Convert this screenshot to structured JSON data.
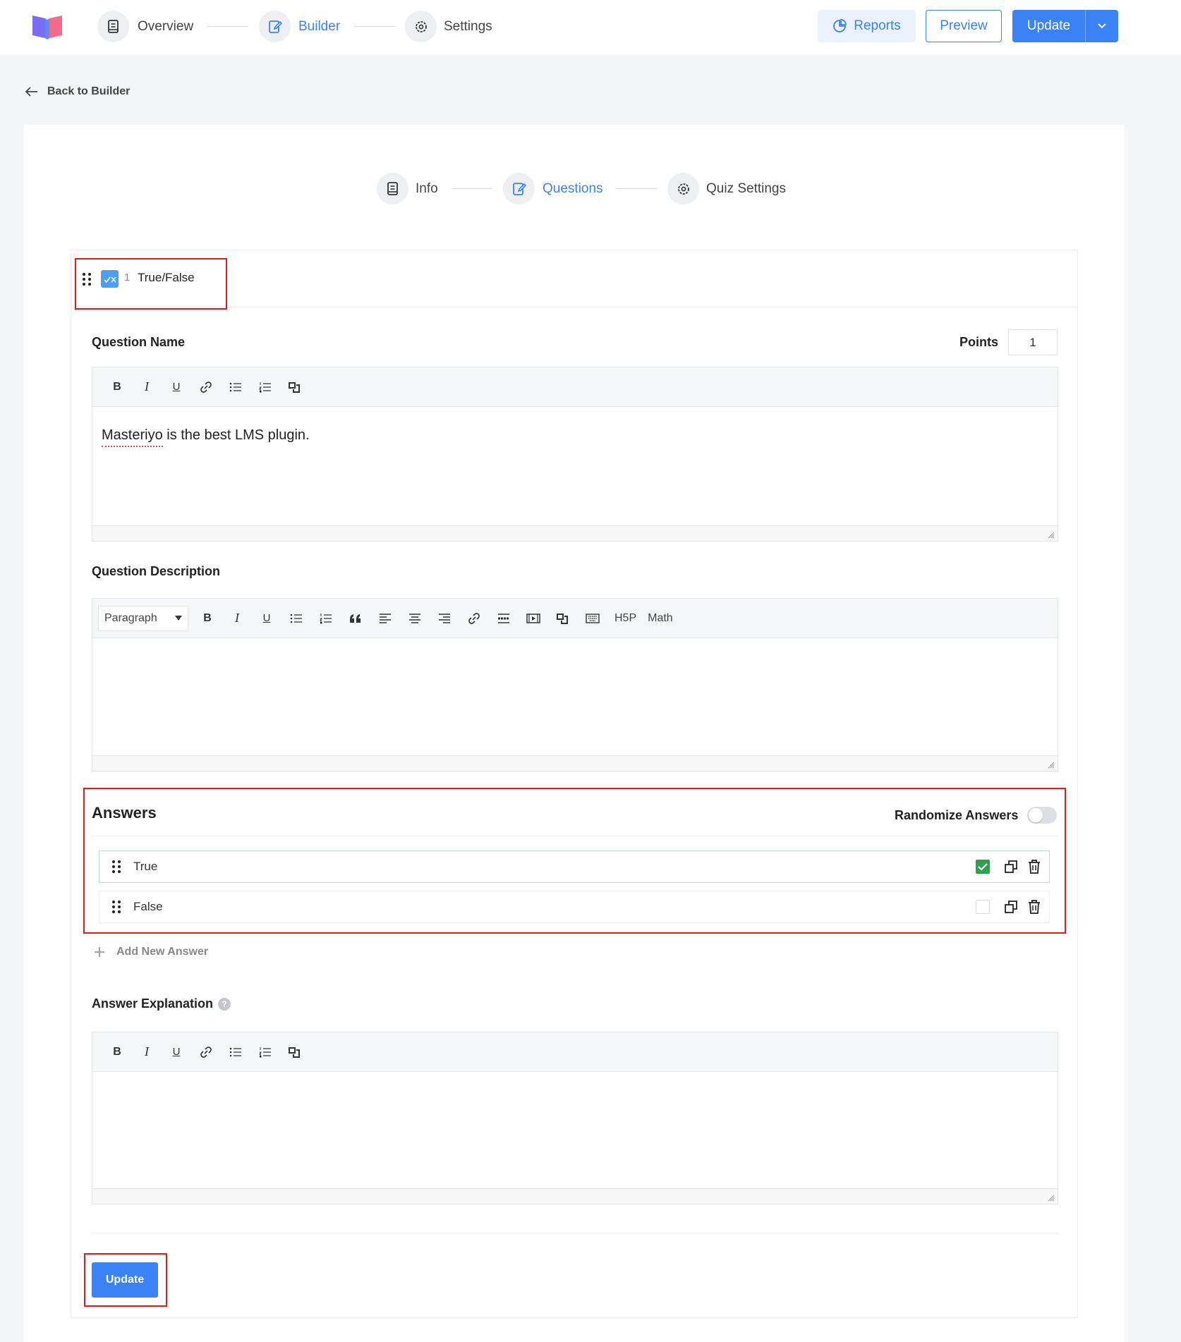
{
  "nav": {
    "steps": [
      {
        "label": "Overview",
        "icon": "book-icon"
      },
      {
        "label": "Builder",
        "icon": "edit-icon"
      },
      {
        "label": "Settings",
        "icon": "gear-icon"
      }
    ],
    "reports_label": "Reports",
    "preview_label": "Preview",
    "update_label": "Update"
  },
  "back_link": "Back to Builder",
  "quiz_steps": [
    {
      "label": "Info",
      "icon": "book-icon"
    },
    {
      "label": "Questions",
      "icon": "edit-icon"
    },
    {
      "label": "Quiz Settings",
      "icon": "gear-icon"
    }
  ],
  "question": {
    "number": "1",
    "type": "True/False",
    "name_label": "Question Name",
    "points_label": "Points",
    "points_value": "1",
    "name_text": "Masteriyo is the best LMS plugin.",
    "description_label": "Question Description",
    "format_select": "Paragraph",
    "toolbar_extra": {
      "h5p": "H5P",
      "math": "Math"
    },
    "answers_label": "Answers",
    "randomize_label": "Randomize Answers",
    "randomize_on": false,
    "answers": [
      {
        "label": "True",
        "correct": true
      },
      {
        "label": "False",
        "correct": false
      }
    ],
    "add_answer_label": "Add New Answer",
    "explanation_label": "Answer Explanation",
    "update_label": "Update"
  },
  "colors": {
    "accent": "#3b82f6",
    "correct": "#2e9e4f",
    "highlight": "#e21a1a"
  }
}
